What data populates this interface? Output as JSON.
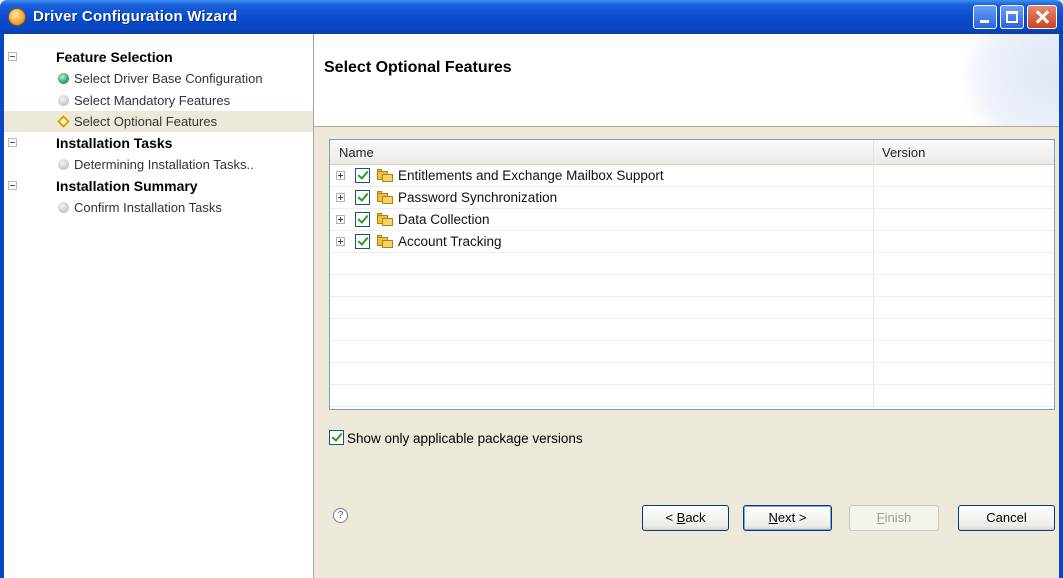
{
  "window": {
    "title": "Driver Configuration Wizard"
  },
  "nav": {
    "groups": [
      {
        "label": "Feature Selection",
        "items": [
          {
            "label": "Select Driver Base Configuration",
            "state": "complete"
          },
          {
            "label": "Select Mandatory Features",
            "state": "pending"
          },
          {
            "label": "Select Optional Features",
            "state": "current"
          }
        ]
      },
      {
        "label": "Installation Tasks",
        "items": [
          {
            "label": "Determining Installation Tasks..",
            "state": "pending"
          }
        ]
      },
      {
        "label": "Installation Summary",
        "items": [
          {
            "label": "Confirm Installation Tasks",
            "state": "pending"
          }
        ]
      }
    ]
  },
  "page": {
    "title": "Select Optional Features"
  },
  "table": {
    "columns": [
      "Name",
      "Version"
    ],
    "rows": [
      {
        "name": "Entitlements and Exchange Mailbox Support",
        "version": "",
        "checked": true
      },
      {
        "name": "Password Synchronization",
        "version": "",
        "checked": true
      },
      {
        "name": "Data Collection",
        "version": "",
        "checked": true
      },
      {
        "name": "Account Tracking",
        "version": "",
        "checked": true
      }
    ]
  },
  "options": {
    "show_applicable_label": "Show only applicable package versions",
    "show_applicable_checked": true
  },
  "footer": {
    "help_icon": "?",
    "back": {
      "prefix": "< ",
      "mnemonic": "B",
      "rest": "ack"
    },
    "next": {
      "mnemonic": "N",
      "rest": "ext >"
    },
    "finish": {
      "mnemonic": "F",
      "rest": "inish"
    },
    "cancel": "Cancel"
  }
}
